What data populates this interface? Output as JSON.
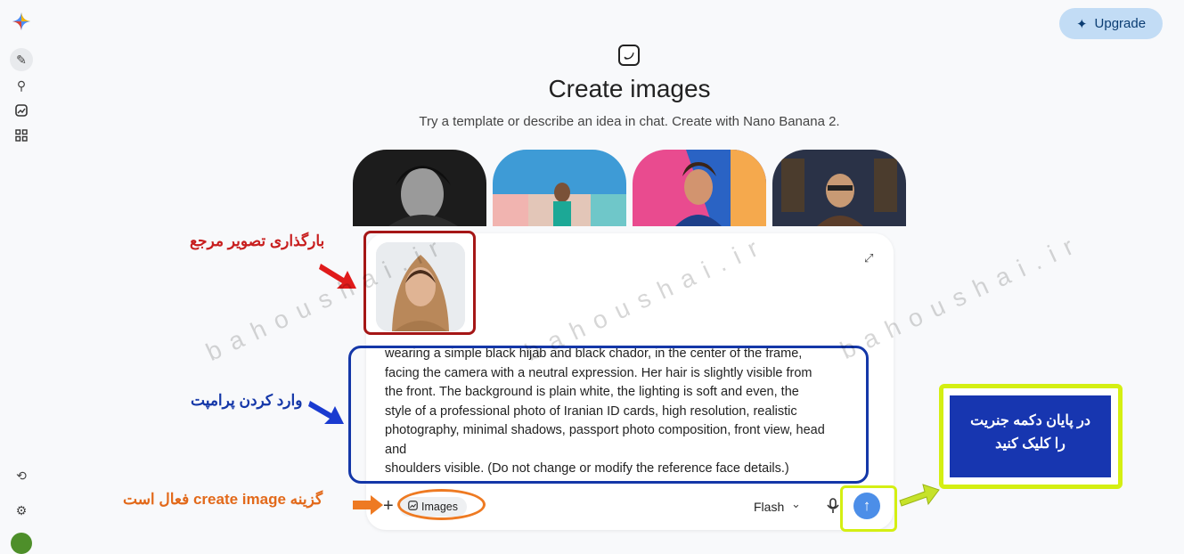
{
  "header": {
    "upgrade_label": "Upgrade"
  },
  "hero": {
    "title": "Create images",
    "subtitle": "Try a template or describe an idea in chat. Create with Nano Banana 2."
  },
  "templates": [
    "template-1",
    "template-2",
    "template-3",
    "template-4"
  ],
  "composer": {
    "prompt_lines": "wearing a simple black hijab and black chador, in the center of the frame,\nfacing the camera with a neutral expression. Her hair is slightly visible from\nthe front. The background is plain white, the lighting is soft and even, the\nstyle of a professional photo of Iranian ID cards, high resolution, realistic\nphotography, minimal shadows, passport photo composition, front view, head\nand\nshoulders visible. (Do not change or modify the reference face details.)",
    "tool_chip_label": "Images",
    "model_label": "Flash"
  },
  "annotations": {
    "upload_reference": "بارگذاری تصویر مرجع",
    "enter_prompt": "وارد کردن پرامپت",
    "create_image_active": "گزینه create image فعال است",
    "generate_note_line1": "در پایان دکمه جنریت",
    "generate_note_line2": "را کلیک کنید"
  },
  "watermark": "bahoushai.ir",
  "colors": {
    "red": "#a51616",
    "blue": "#1437a8",
    "orange": "#ee7a22",
    "lime": "#d4ef12",
    "send": "#4c8ee8",
    "upgrade_bg": "#c2dcf5"
  }
}
